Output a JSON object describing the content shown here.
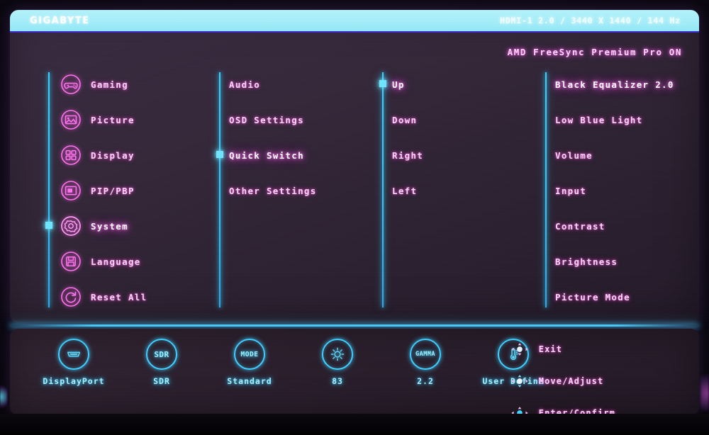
{
  "header": {
    "brand": "GIGABYTE",
    "signal_info": "HDMI-1 2.0 /  3440 X 1440 /  144 Hz",
    "freesync": "AMD FreeSync Premium Pro  ON"
  },
  "columns": [
    {
      "name": "main-menu",
      "selected_index": 4,
      "items": [
        {
          "label": "Gaming",
          "icon": "gamepad-icon",
          "highlight": false
        },
        {
          "label": "Picture",
          "icon": "image-icon",
          "highlight": false
        },
        {
          "label": "Display",
          "icon": "grid-icon",
          "highlight": false
        },
        {
          "label": "PIP/PBP",
          "icon": "pip-icon",
          "highlight": false
        },
        {
          "label": "System",
          "icon": "gear-icon",
          "highlight": true
        },
        {
          "label": "Language",
          "icon": "save-disk-icon",
          "highlight": false
        },
        {
          "label": "Reset All",
          "icon": "reset-icon",
          "highlight": false
        }
      ]
    },
    {
      "name": "system-submenu",
      "selected_index": 2,
      "items": [
        {
          "label": "Audio",
          "highlight": false
        },
        {
          "label": "OSD  Settings",
          "highlight": false
        },
        {
          "label": "Quick  Switch",
          "highlight": true
        },
        {
          "label": "Other  Settings",
          "highlight": false
        }
      ]
    },
    {
      "name": "quick-switch-directions",
      "selected_index": 0,
      "items": [
        {
          "label": "Up",
          "highlight": true
        },
        {
          "label": "Down",
          "highlight": false
        },
        {
          "label": "Right",
          "highlight": false
        },
        {
          "label": "Left",
          "highlight": false
        }
      ]
    },
    {
      "name": "quick-switch-assign",
      "selected_index": -1,
      "items": [
        {
          "label": "Black  Equalizer  2.0",
          "highlight": true
        },
        {
          "label": "Low  Blue  Light",
          "highlight": false
        },
        {
          "label": "Volume",
          "highlight": false
        },
        {
          "label": "Input",
          "highlight": false
        },
        {
          "label": "Contrast",
          "highlight": false
        },
        {
          "label": "Brightness",
          "highlight": false
        },
        {
          "label": "Picture  Mode",
          "highlight": false
        }
      ]
    }
  ],
  "status_bar": {
    "items": [
      {
        "icon": "displayport-icon",
        "badge": "",
        "label": "DisplayPort"
      },
      {
        "icon": "sdr-badge-icon",
        "badge": "SDR",
        "label": "SDR"
      },
      {
        "icon": "mode-badge-icon",
        "badge": "MODE",
        "label": "Standard"
      },
      {
        "icon": "brightness-sun-icon",
        "badge": "",
        "label": "83"
      },
      {
        "icon": "gamma-badge-icon",
        "badge": "GAMMA",
        "label": "2.2"
      },
      {
        "icon": "thermometer-icon",
        "badge": "",
        "label": "User  Define"
      }
    ],
    "nav_hints": [
      {
        "icon": "joystick-icon",
        "label": "Exit"
      },
      {
        "icon": "joystick-icon",
        "label": "Move/Adjust"
      },
      {
        "icon": "joystick-icon",
        "label": "Enter/Confirm"
      }
    ]
  },
  "colors": {
    "cyan": "#3fd0ff",
    "magenta": "#ff5be6",
    "panel": "#31243a",
    "titlebar": "#a4eefa"
  }
}
